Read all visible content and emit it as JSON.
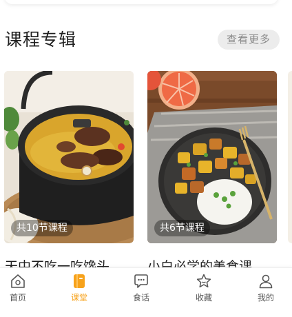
{
  "section": {
    "title": "课程专辑",
    "more_label": "查看更多"
  },
  "cards": [
    {
      "badge": "共10节课程",
      "title": "天中不吃一吃馋头"
    },
    {
      "badge": "共6节课程",
      "title": "小白必学的美食课"
    }
  ],
  "tabbar": {
    "items": [
      {
        "label": "首页",
        "icon": "home-icon",
        "active": false
      },
      {
        "label": "课堂",
        "icon": "book-icon",
        "active": true
      },
      {
        "label": "食话",
        "icon": "chat-icon",
        "active": false
      },
      {
        "label": "收藏",
        "icon": "star-icon",
        "active": false
      },
      {
        "label": "我的",
        "icon": "user-icon",
        "active": false
      }
    ]
  },
  "colors": {
    "accent": "#f7a21b",
    "more_bg": "#ececec",
    "inactive": "#555555"
  }
}
